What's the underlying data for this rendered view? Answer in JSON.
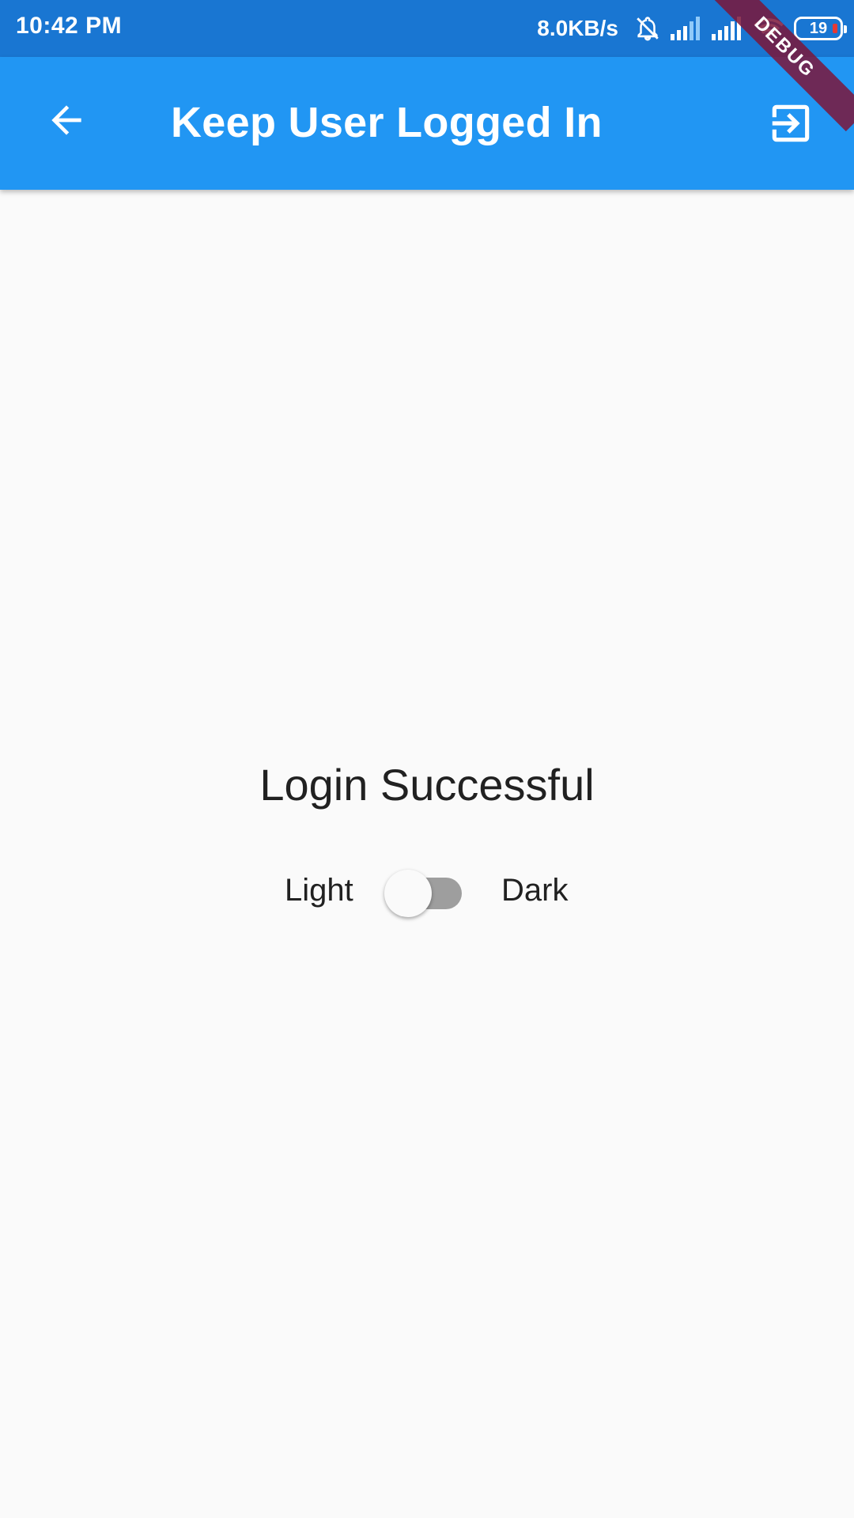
{
  "status_bar": {
    "time": "10:42 PM",
    "network_speed": "8.0KB/s",
    "battery_level": "19",
    "icons": [
      "bell-off-icon",
      "signal-icon",
      "signal-icon",
      "wifi-icon",
      "battery-icon"
    ]
  },
  "app_bar": {
    "title": "Keep User Logged In",
    "leading_icon": "arrow-back-icon",
    "action_icon": "login-icon",
    "color": "#2196f3"
  },
  "debug_banner": "DEBUG",
  "main": {
    "message": "Login Successful",
    "theme_toggle": {
      "left_label": "Light",
      "right_label": "Dark",
      "checked": false
    }
  },
  "colors": {
    "status_bar": "#1976d2",
    "app_bar": "#2196f3",
    "background": "#fafafa",
    "text": "#212121",
    "switch_track_off": "#9e9e9e",
    "debug_banner": "#7b1639"
  }
}
